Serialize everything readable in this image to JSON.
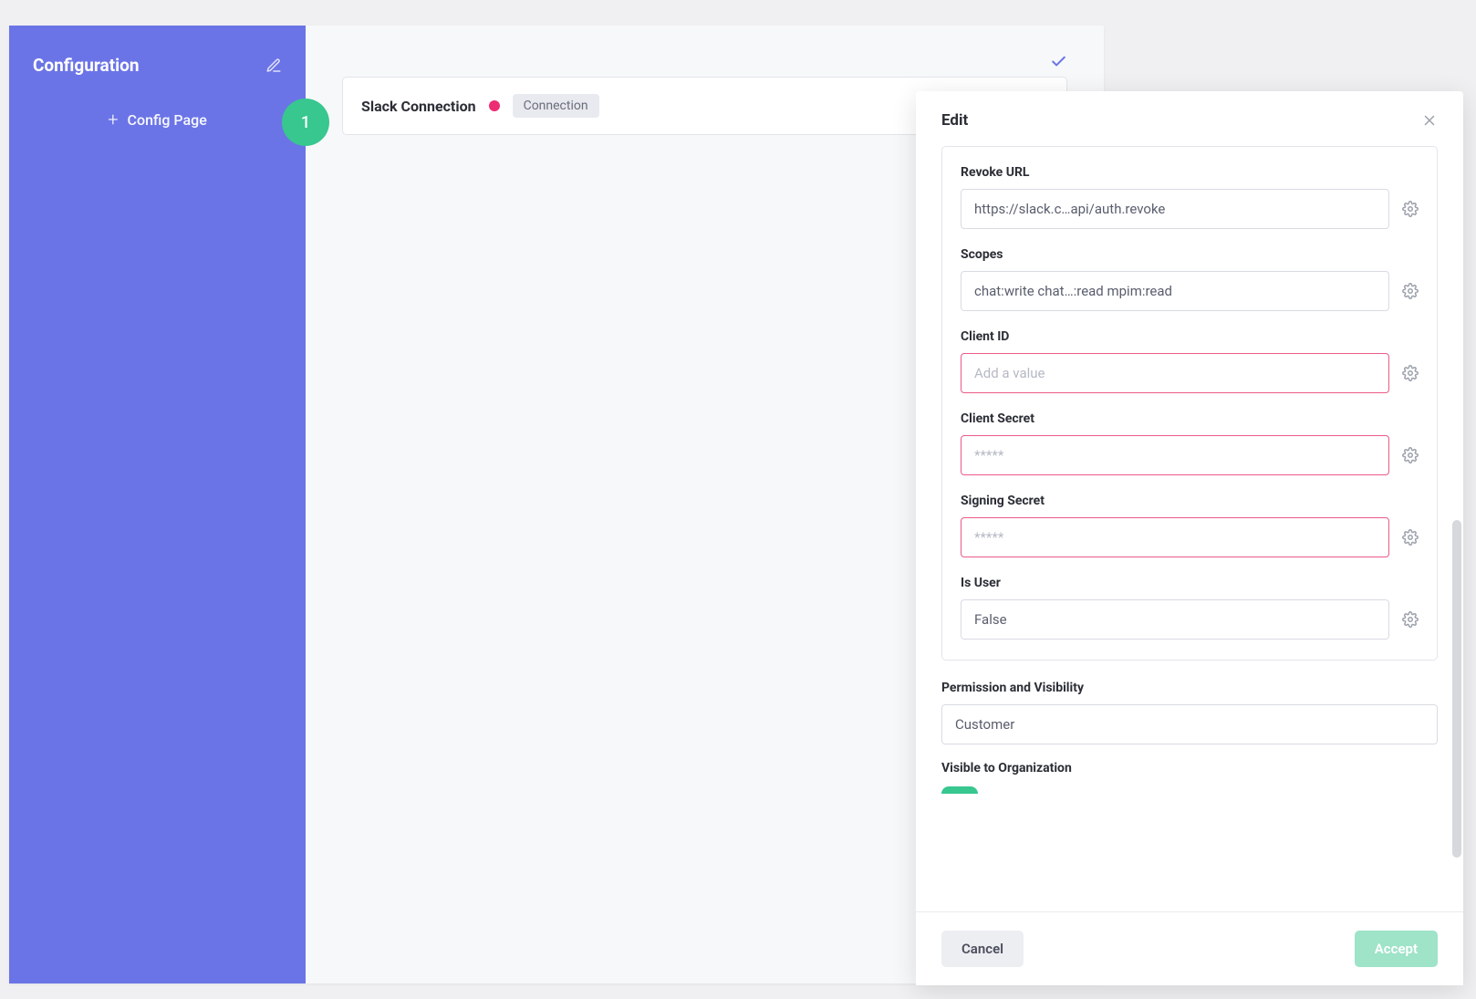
{
  "sidebar": {
    "title": "Configuration",
    "badge": "1",
    "addLabel": "Config Page"
  },
  "main": {
    "cardTitle": "Slack Connection",
    "tag": "Connection"
  },
  "panel": {
    "title": "Edit",
    "fields": {
      "revokeUrl": {
        "label": "Revoke URL",
        "value": "https://slack.c…api/auth.revoke"
      },
      "scopes": {
        "label": "Scopes",
        "value": "chat:write chat…:read mpim:read"
      },
      "clientId": {
        "label": "Client ID",
        "value": "",
        "placeholder": "Add a value"
      },
      "clientSecret": {
        "label": "Client Secret",
        "value": "",
        "placeholder": "*****"
      },
      "signingSecret": {
        "label": "Signing Secret",
        "value": "",
        "placeholder": "*****"
      },
      "isUser": {
        "label": "Is User",
        "value": "False"
      }
    },
    "permission": {
      "label": "Permission and Visibility",
      "value": "Customer"
    },
    "visibleOrg": {
      "label": "Visible to Organization"
    },
    "buttons": {
      "cancel": "Cancel",
      "accept": "Accept"
    }
  }
}
